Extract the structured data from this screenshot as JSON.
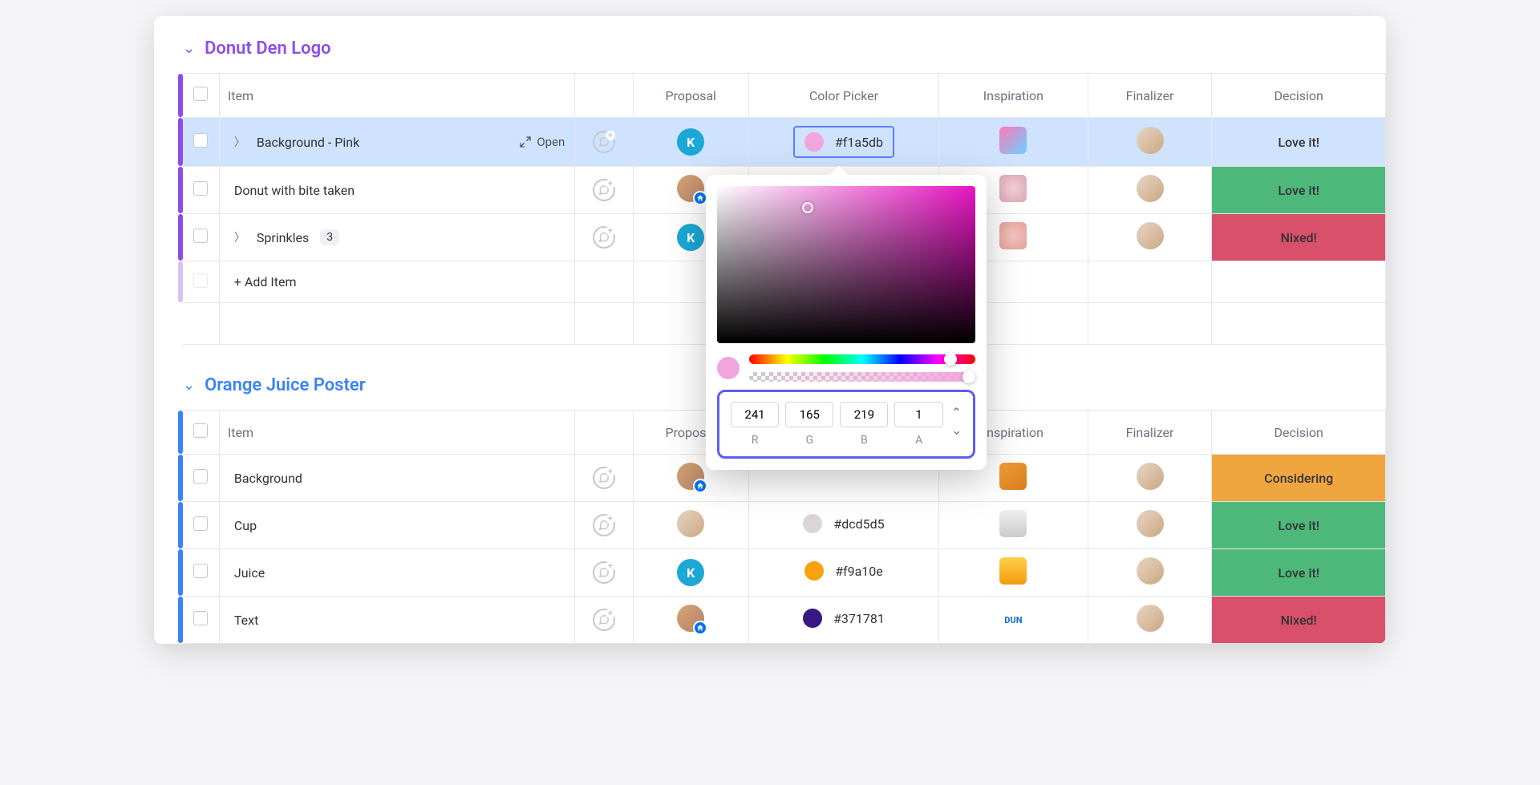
{
  "columns": {
    "item": "Item",
    "proposal": "Proposal",
    "color_picker": "Color Picker",
    "inspiration": "Inspiration",
    "finalizer": "Finalizer",
    "decision": "Decision"
  },
  "groups": [
    {
      "title": "Donut Den Logo",
      "color_class": "g-purple",
      "rows": [
        {
          "name": "Background - Pink",
          "expandable": true,
          "selected": true,
          "open": true,
          "proposal_avatar": "K",
          "color_hex": "#f1a5db",
          "swatch": "#f1a5db",
          "insp": "linear-gradient(135deg,#ff7ab6,#6ad0ff)",
          "decision": "Love it!",
          "decision_class": "d-love-light"
        },
        {
          "name": "Donut with bite taken",
          "proposal_avatar": "photo",
          "badge": true,
          "insp": "radial-gradient(circle,#f3d1d8,#d9a5b2)",
          "decision": "Love it!",
          "decision_class": "d-love"
        },
        {
          "name": "Sprinkles",
          "expandable": true,
          "count": "3",
          "proposal_avatar": "K",
          "insp": "radial-gradient(circle,#f3c7c2,#e5a097)",
          "decision": "Nixed!",
          "decision_class": "d-nix"
        }
      ],
      "add_item": "+ Add Item"
    },
    {
      "title": "Orange Juice Poster",
      "color_class": "g-blue",
      "rows": [
        {
          "name": "Background",
          "proposal_avatar": "photo",
          "badge": true,
          "insp": "linear-gradient(135deg,#f0a23a,#d97b1a)",
          "decision": "Considering",
          "decision_class": "d-consider"
        },
        {
          "name": "Cup",
          "proposal_avatar": "photo2",
          "color_hex": "#dcd5d5",
          "swatch": "#dcd5d5",
          "insp": "linear-gradient(#eee,#ccc)",
          "decision": "Love it!",
          "decision_class": "d-love"
        },
        {
          "name": "Juice",
          "proposal_avatar": "K",
          "color_hex": "#f9a10e",
          "swatch": "#f9a10e",
          "insp": "linear-gradient(#ffcf4a,#f39b0c)",
          "decision": "Love it!",
          "decision_class": "d-love"
        },
        {
          "name": "Text",
          "proposal_avatar": "photo",
          "badge": true,
          "color_hex": "#371781",
          "swatch": "#371781",
          "insp": "#1976d2",
          "insp_text": "DUN",
          "decision": "Nixed!",
          "decision_class": "d-nix"
        }
      ]
    }
  ],
  "open_label": "Open",
  "picker": {
    "r": "241",
    "g": "165",
    "b": "219",
    "a": "1",
    "labels": {
      "r": "R",
      "g": "G",
      "b": "B",
      "a": "A"
    },
    "preview": "#f1a5db"
  }
}
